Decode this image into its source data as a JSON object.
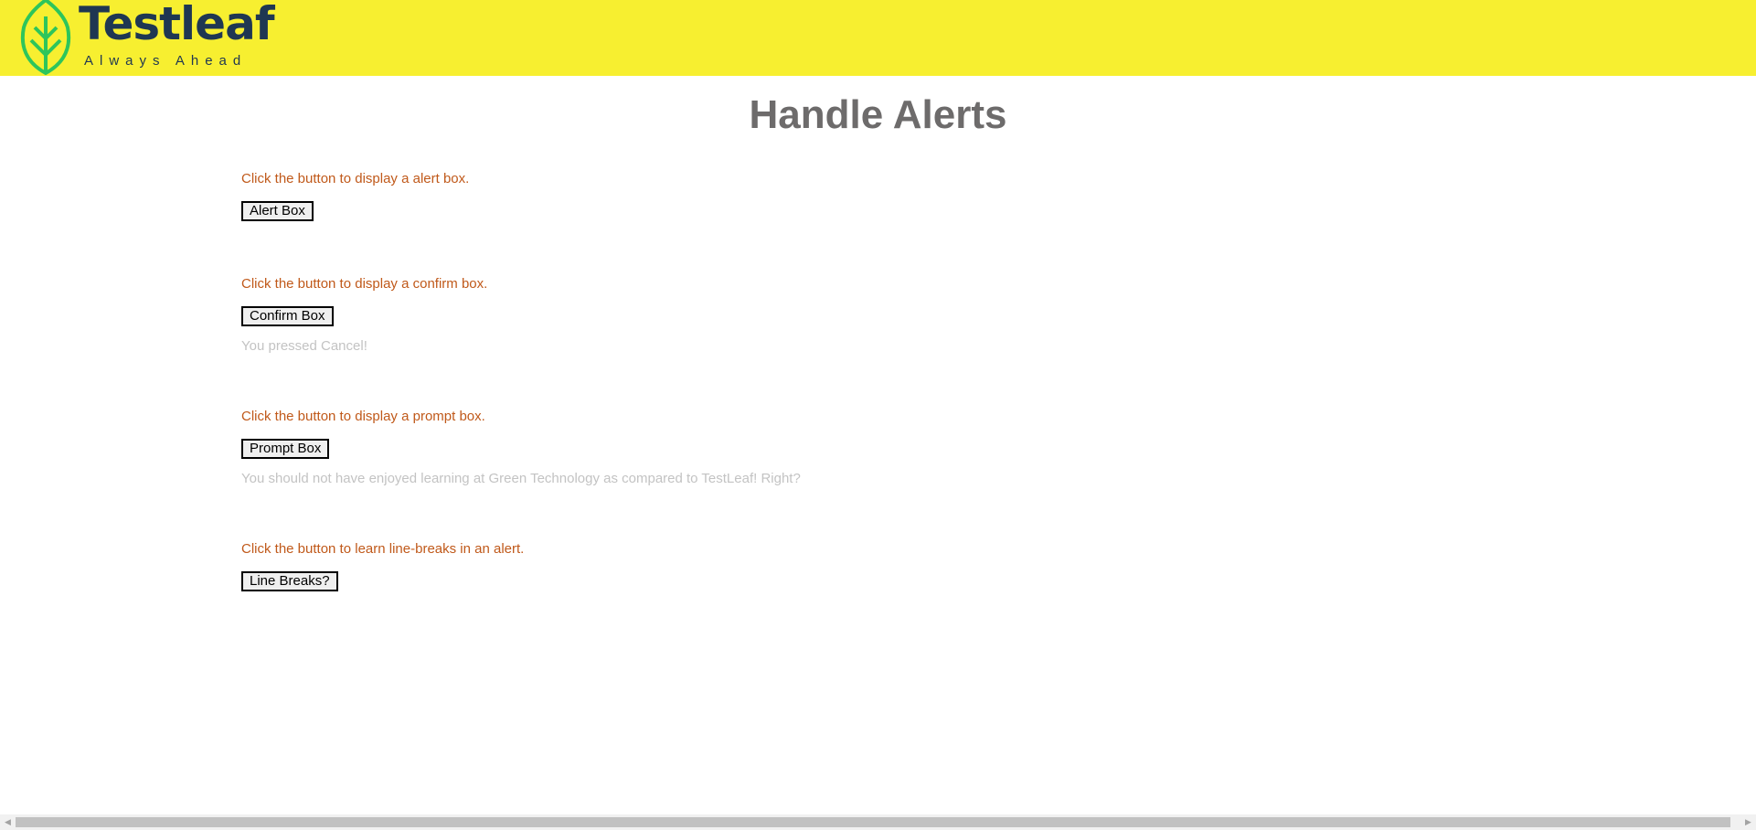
{
  "header": {
    "brand": "Testleaf",
    "tagline": "Always Ahead",
    "colors": {
      "background": "#f7ef30",
      "brand": "#1f3752",
      "leaf": "#2ec55b"
    }
  },
  "page": {
    "title": "Handle Alerts"
  },
  "sections": [
    {
      "instruction": "Click the button to display a alert box.",
      "button_label": "Alert Box"
    },
    {
      "instruction": "Click the button to display a confirm box.",
      "button_label": "Confirm Box",
      "result": "You pressed Cancel!"
    },
    {
      "instruction": "Click the button to display a prompt box.",
      "button_label": "Prompt Box",
      "result": "You should not have enjoyed learning at Green Technology as compared to TestLeaf! Right?"
    },
    {
      "instruction": "Click the button to learn line-breaks in an alert.",
      "button_label": "Line Breaks?"
    }
  ],
  "scrollbar": {
    "left_icon": "chevron-left-icon",
    "right_icon": "chevron-right-icon"
  }
}
